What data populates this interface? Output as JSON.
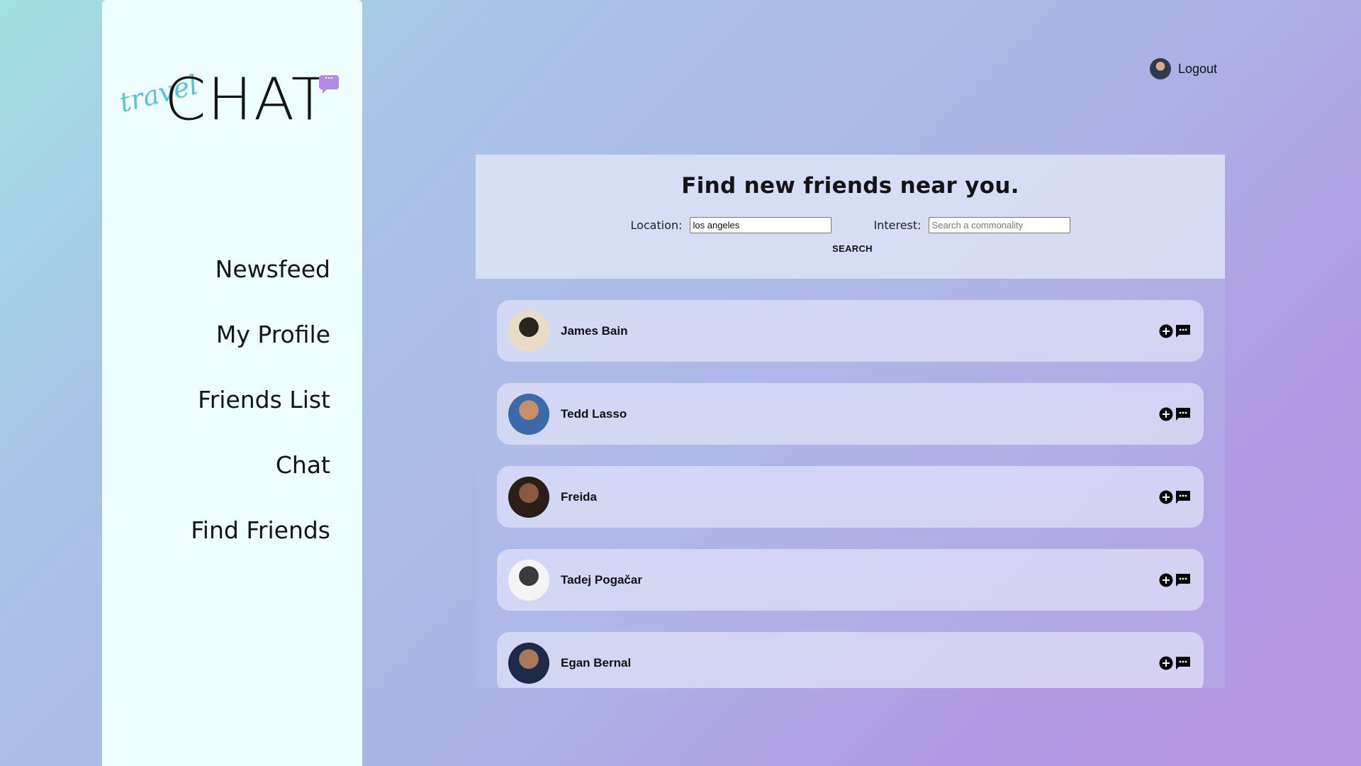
{
  "app": {
    "logo_word": "CHAT",
    "logo_script": "travel",
    "logo_bubble": "···"
  },
  "sidebar": {
    "items": [
      {
        "label": "Newsfeed"
      },
      {
        "label": "My Profile"
      },
      {
        "label": "Friends List"
      },
      {
        "label": "Chat"
      },
      {
        "label": "Find Friends"
      }
    ]
  },
  "header": {
    "logout_label": "Logout"
  },
  "search": {
    "title": "Find new friends near you.",
    "location_label": "Location:",
    "location_value": "los angeles",
    "interest_label": "Interest:",
    "interest_placeholder": "Search a commonality",
    "search_label": "SEARCH"
  },
  "results": [
    {
      "name": "James Bain",
      "avatar_colors": [
        "#e8dcc6",
        "#2a2420"
      ]
    },
    {
      "name": "Tedd Lasso",
      "avatar_colors": [
        "#3a6aa8",
        "#c98e6a"
      ]
    },
    {
      "name": "Freida",
      "avatar_colors": [
        "#2b1d18",
        "#8a5a40"
      ]
    },
    {
      "name": "Tadej Pogačar",
      "avatar_colors": [
        "#f4f4f4",
        "#3a3a3a"
      ]
    },
    {
      "name": "Egan Bernal",
      "avatar_colors": [
        "#1d2a4a",
        "#a8785c"
      ]
    }
  ],
  "icons": {
    "add": "plus-circle-icon",
    "message": "chat-bubble-icon"
  }
}
